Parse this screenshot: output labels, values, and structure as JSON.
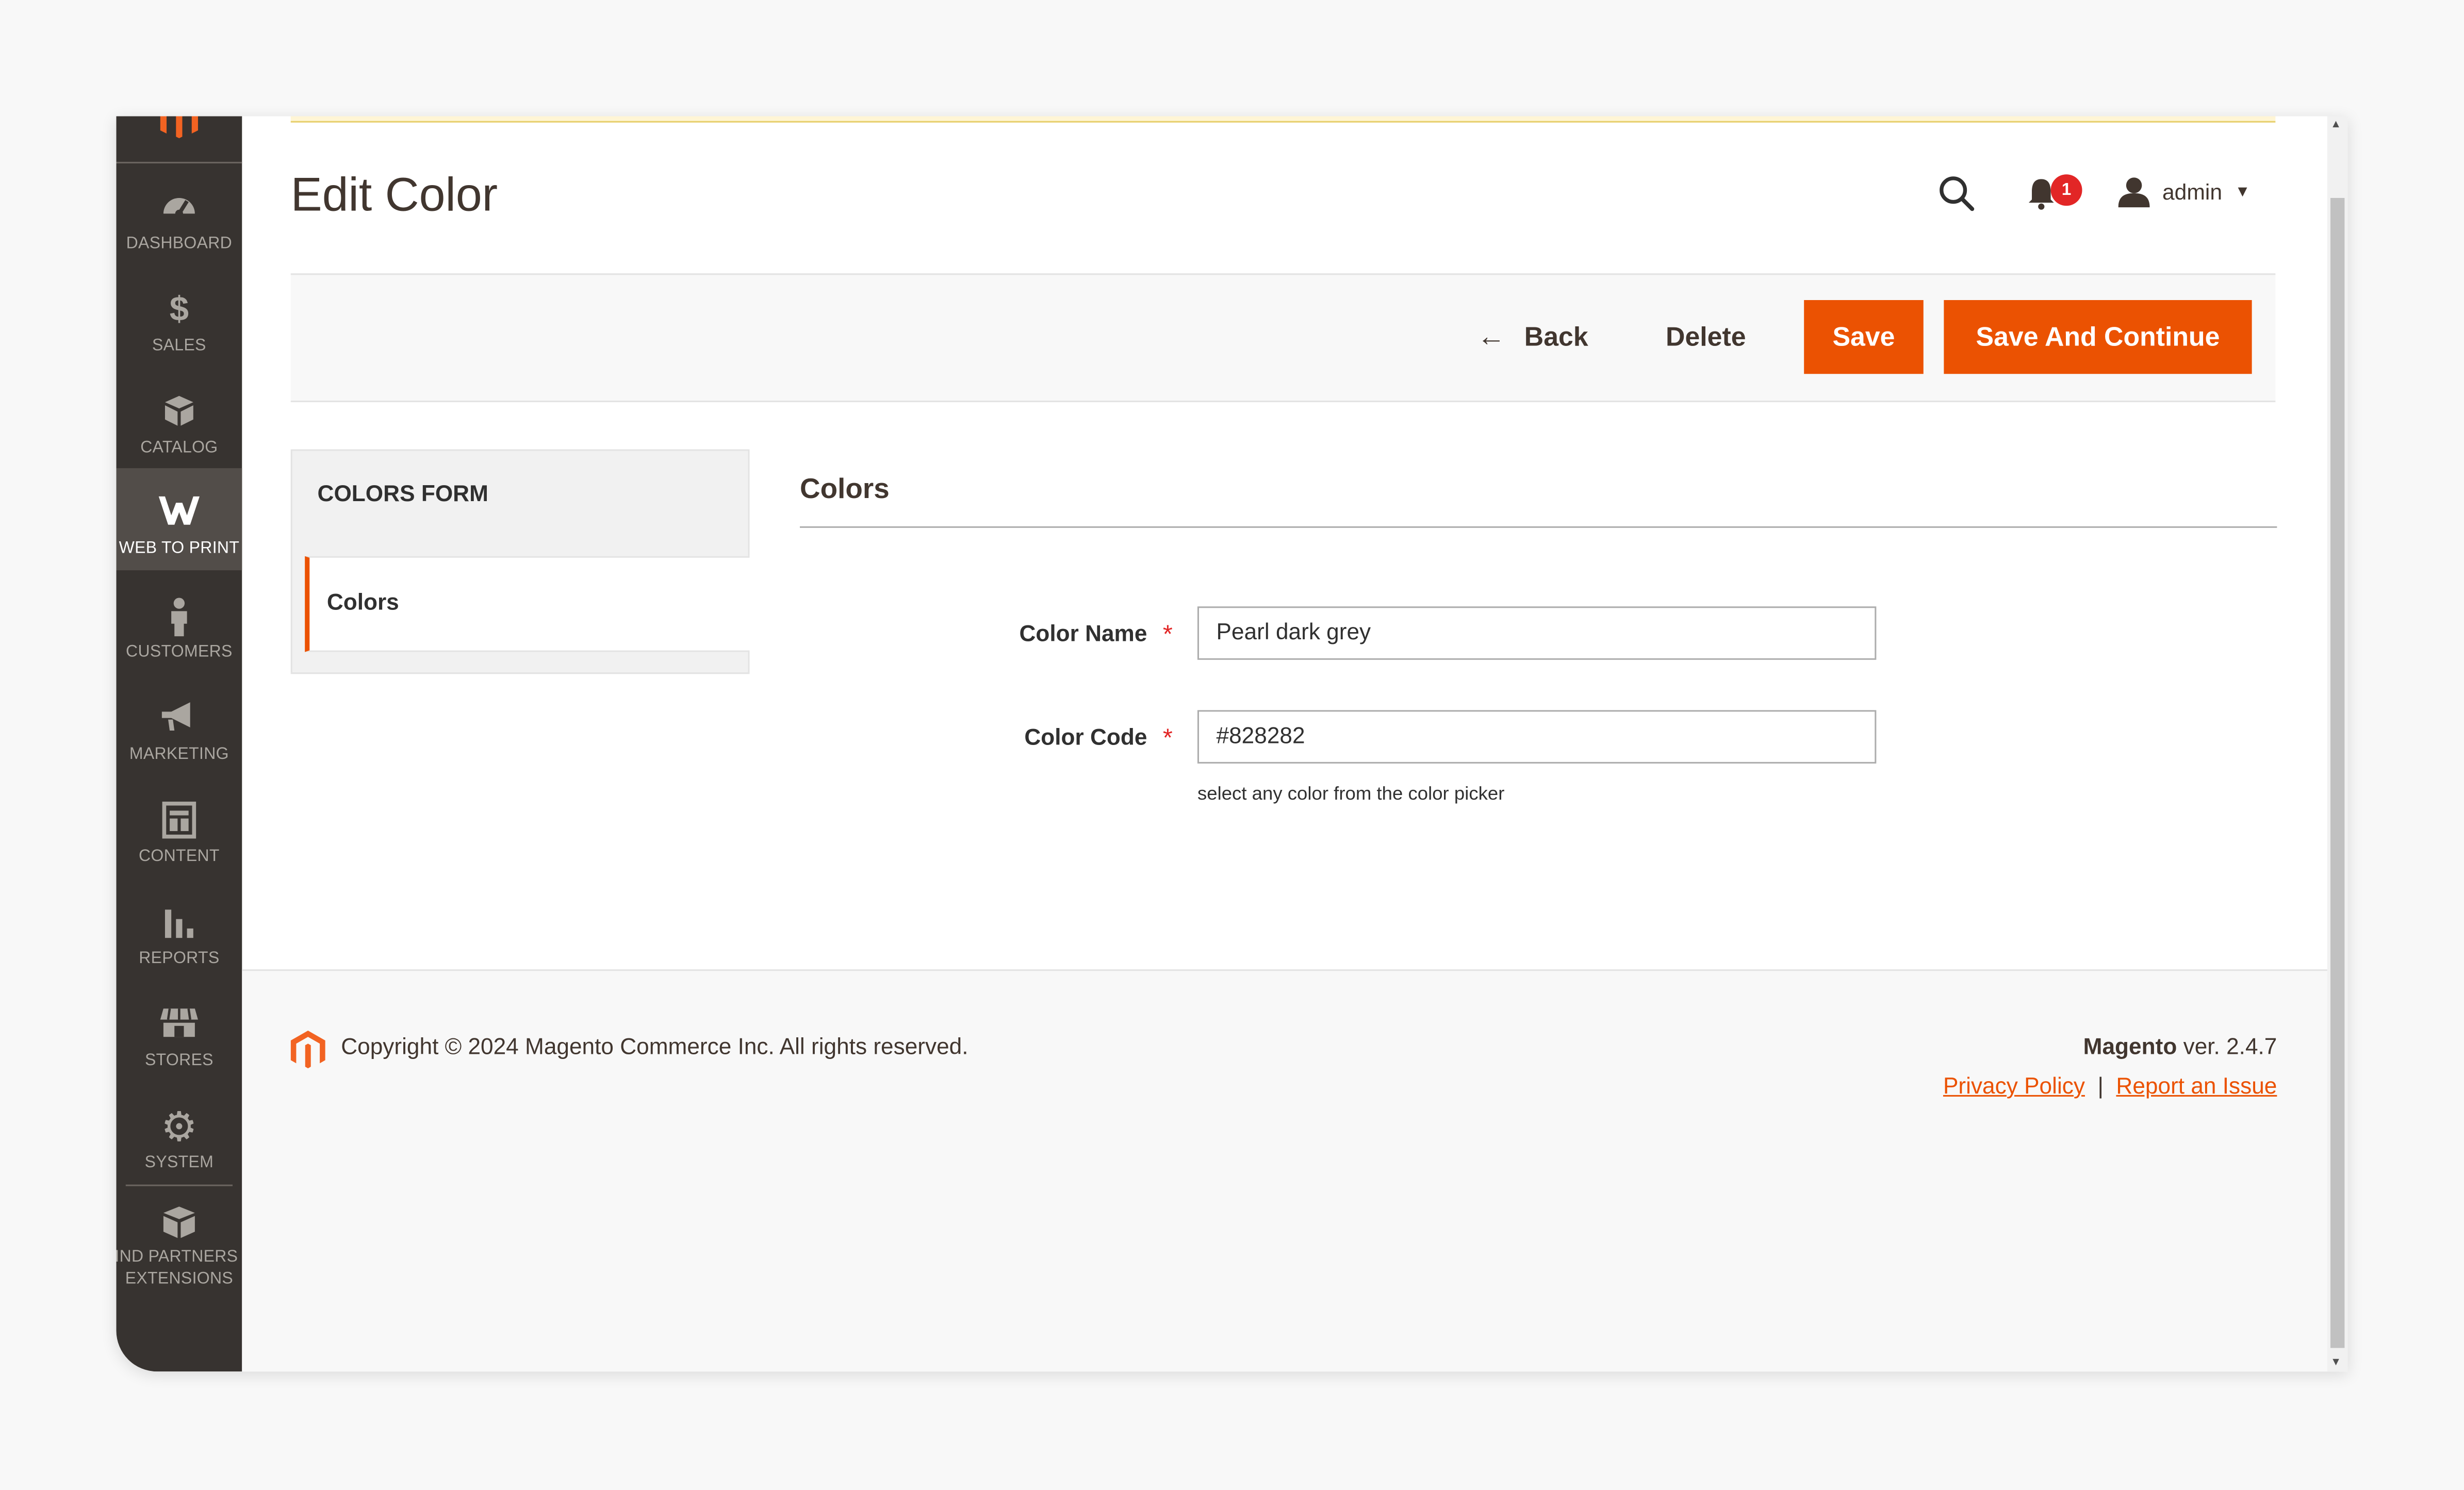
{
  "page": {
    "title": "Edit Color"
  },
  "header": {
    "user_name": "admin",
    "notification_count": "1"
  },
  "sidebar": {
    "items": [
      {
        "label": "Dashboard",
        "icon": "dashboard-icon"
      },
      {
        "label": "Sales",
        "icon": "dollar-icon"
      },
      {
        "label": "Catalog",
        "icon": "box-icon"
      },
      {
        "label": "Web to Print",
        "icon": "web-to-print-icon",
        "active": true
      },
      {
        "label": "Customers",
        "icon": "person-icon"
      },
      {
        "label": "Marketing",
        "icon": "megaphone-icon"
      },
      {
        "label": "Content",
        "icon": "layout-icon"
      },
      {
        "label": "Reports",
        "icon": "bar-chart-icon"
      },
      {
        "label": "Stores",
        "icon": "store-icon"
      },
      {
        "label": "System",
        "icon": "gear-icon"
      },
      {
        "label": "Find Partners & Extensions",
        "icon": "cubes-icon"
      }
    ]
  },
  "actions": {
    "back": "Back",
    "delete": "Delete",
    "save": "Save",
    "save_continue": "Save And Continue"
  },
  "tabs": {
    "title": "Colors Form",
    "items": [
      {
        "label": "Colors",
        "active": true
      }
    ]
  },
  "form": {
    "fieldset_title": "Colors",
    "color_name": {
      "label": "Color Name",
      "value": "Pearl dark grey"
    },
    "color_code": {
      "label": "Color Code",
      "value": "#828282",
      "note": "select any color from the color picker"
    }
  },
  "footer": {
    "copyright": "Copyright © 2024 Magento Commerce Inc. All rights reserved.",
    "brand": "Magento",
    "version": " ver. 2.4.7",
    "privacy": "Privacy Policy",
    "separator": "|",
    "report": "Report an Issue"
  },
  "colors": {
    "accent": "#eb5202",
    "sidebar_bg": "#373330",
    "sidebar_active": "#524d49",
    "text": "#41362f",
    "badge": "#e22626"
  }
}
